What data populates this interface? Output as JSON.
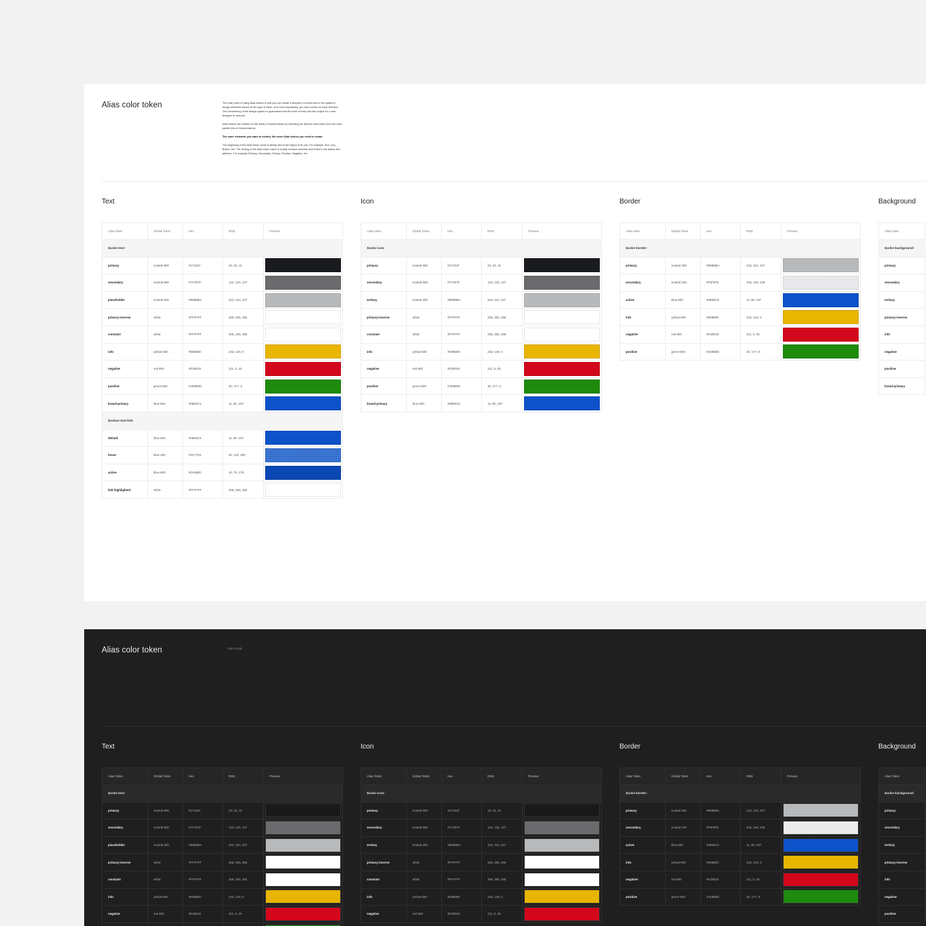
{
  "light": {
    "title": "Alias color token",
    "description": [
      "The main point of using Alias tokens is that you can create a structure of colors tied to the system's design elements based on the type of token. And most importantly, per color control for each element. The consistency of the design system is guaranteed and the level of entry into the project for a new designer is reduced.",
      "Alias tokens are created on the basis of Global tokens by selecting the desired color token from the color palette (list of Global tokens).",
      "The more elements you want to control, the more Alias tokens you need to create.",
      "The beginning of the Alias token name is strictly tied to the object of its use. For example Text, Icon, Button, etc. The ending of the Alias token name is mostly emotion-oriented and is tied to the status and attribute. For example Primary, Secondary, Tertiary, Positive, Negative, etc."
    ],
    "sections": [
      {
        "heading": "Text",
        "columns": [
          "Alias token",
          "Global Token",
          "Hex",
          "RGB",
          "Preview"
        ],
        "groups": [
          {
            "label": "$color-text-",
            "rows": [
              {
                "alias": "primary",
                "global": "neutral-900",
                "hex": "#17191F",
                "rgb": "23, 25, 31",
                "swatch": "#1a1b1f"
              },
              {
                "alias": "secondary",
                "global": "neutral-600",
                "hex": "#7A7E7F",
                "rgb": "122, 126, 127",
                "swatch": "#6b6b6e"
              },
              {
                "alias": "placeholder",
                "global": "neutral-300",
                "hex": "#B8B9BA",
                "rgb": "223, 224, 227",
                "swatch": "#b8b9bb"
              },
              {
                "alias": "primary-inverse",
                "global": "white",
                "hex": "#FFFFFF",
                "rgb": "255, 255, 255",
                "swatch": "#ffffff"
              },
              {
                "alias": "constant",
                "global": "white",
                "hex": "#FFFFFF",
                "rgb": "255, 255, 255",
                "swatch": "#ffffff"
              },
              {
                "alias": "info",
                "global": "yellow-600",
                "hex": "#E8B800",
                "rgb": "232, 149, 0",
                "swatch": "#e8b500"
              },
              {
                "alias": "negative",
                "global": "red-600",
                "hex": "#D30519",
                "rgb": "211, 5, 25",
                "swatch": "#d3061c"
              },
              {
                "alias": "positive",
                "global": "green-600",
                "hex": "#1E8B0D",
                "rgb": "30, 177, 0",
                "swatch": "#1e8b0d"
              },
              {
                "alias": "brand-primary",
                "global": "blue-500",
                "hex": "#0B50C5",
                "rgb": "11, 80, 197",
                "swatch": "#0d52c9"
              }
            ]
          },
          {
            "label": "$colour-text-link-",
            "rows": [
              {
                "alias": "default",
                "global": "blue-500",
                "hex": "#0B50C5",
                "rgb": "11, 80, 197",
                "swatch": "#0d52c9"
              },
              {
                "alias": "hover",
                "global": "blue-400",
                "hex": "#3C77D1",
                "rgb": "60, 119, 209",
                "swatch": "#3d78d8"
              },
              {
                "alias": "active",
                "global": "blue-600",
                "hex": "#0A46B0",
                "rgb": "10, 70, 176",
                "swatch": "#0a47b3"
              },
              {
                "alias": "link-highlighted",
                "global": "white",
                "hex": "#FFFFFF",
                "rgb": "255, 255, 255",
                "swatch": "#ffffff"
              }
            ]
          }
        ]
      },
      {
        "heading": "Icon",
        "columns": [
          "Alias token",
          "Global Token",
          "Hex",
          "RGB",
          "Preview"
        ],
        "groups": [
          {
            "label": "$color-icon-",
            "rows": [
              {
                "alias": "primary",
                "global": "neutral-900",
                "hex": "#17191F",
                "rgb": "23, 25, 31",
                "swatch": "#1a1b1f"
              },
              {
                "alias": "secondary",
                "global": "neutral-600",
                "hex": "#7A7E7F",
                "rgb": "122, 126, 127",
                "swatch": "#6b6b6e"
              },
              {
                "alias": "tertiary",
                "global": "neutral-300",
                "hex": "#B8B9BA",
                "rgb": "223, 224, 227",
                "swatch": "#b8b9bb"
              },
              {
                "alias": "primary-inverse",
                "global": "white",
                "hex": "#FFFFFF",
                "rgb": "255, 255, 255",
                "swatch": "#ffffff"
              },
              {
                "alias": "constant",
                "global": "white",
                "hex": "#FFFFFF",
                "rgb": "255, 255, 255",
                "swatch": "#ffffff"
              },
              {
                "alias": "info",
                "global": "yellow-600",
                "hex": "#E8B800",
                "rgb": "232, 149, 0",
                "swatch": "#e8b500"
              },
              {
                "alias": "negative",
                "global": "red-600",
                "hex": "#D30519",
                "rgb": "211, 5, 25",
                "swatch": "#d3061c"
              },
              {
                "alias": "positive",
                "global": "green-600",
                "hex": "#1E8B0D",
                "rgb": "30, 177, 0",
                "swatch": "#1e8b0d"
              },
              {
                "alias": "brand-primary",
                "global": "blue-500",
                "hex": "#0B50C5",
                "rgb": "11, 80, 197",
                "swatch": "#0d52c9"
              }
            ]
          }
        ]
      },
      {
        "heading": "Border",
        "columns": [
          "Alias token",
          "Global Token",
          "Hex",
          "RGB",
          "Preview"
        ],
        "groups": [
          {
            "label": "$color-border-",
            "rows": [
              {
                "alias": "primary",
                "global": "neutral-300",
                "hex": "#B8B9BA",
                "rgb": "223, 224, 227",
                "swatch": "#b8b9bb"
              },
              {
                "alias": "secondary",
                "global": "neutral-100",
                "hex": "#F5F6F6",
                "rgb": "245, 246, 246",
                "swatch": "#ececee"
              },
              {
                "alias": "active",
                "global": "blue-500",
                "hex": "#0B50C5",
                "rgb": "11, 80, 197",
                "swatch": "#0d52c9"
              },
              {
                "alias": "info",
                "global": "yellow-600",
                "hex": "#E8B800",
                "rgb": "232, 149, 0",
                "swatch": "#e8b500"
              },
              {
                "alias": "negative",
                "global": "red-600",
                "hex": "#D30519",
                "rgb": "211, 5, 25",
                "swatch": "#d3061c"
              },
              {
                "alias": "positive",
                "global": "green-600",
                "hex": "#1E8B0D",
                "rgb": "30, 177, 0",
                "swatch": "#1e8b0d"
              }
            ]
          }
        ]
      },
      {
        "heading": "Background",
        "columns": [
          "Alias token"
        ],
        "groups": [
          {
            "label": "$color-background-",
            "rows": [
              {
                "alias": "primary"
              },
              {
                "alias": "secondary"
              },
              {
                "alias": "tertiary"
              },
              {
                "alias": "primary-inverse"
              },
              {
                "alias": "info"
              },
              {
                "alias": "negative"
              },
              {
                "alias": "positive"
              },
              {
                "alias": "brand-primary"
              }
            ]
          }
        ]
      }
    ]
  },
  "dark": {
    "title": "Alias color token",
    "note": "Dark mode",
    "sections": [
      {
        "heading": "Text",
        "columns": [
          "Alias Token",
          "Global Token",
          "Hex",
          "RGB",
          "Preview"
        ],
        "groups": [
          {
            "label": "$color-text-",
            "rows": [
              {
                "alias": "primary",
                "global": "neutral-900",
                "hex": "#17191F",
                "rgb": "23, 25, 31",
                "swatch": "#19191b"
              },
              {
                "alias": "secondary",
                "global": "neutral-600",
                "hex": "#7A7E7F",
                "rgb": "122, 126, 127",
                "swatch": "#6b6b6e"
              },
              {
                "alias": "placeholder",
                "global": "neutral-300",
                "hex": "#B8B9BA",
                "rgb": "223, 224, 227",
                "swatch": "#b8b9bb"
              },
              {
                "alias": "primary-inverse",
                "global": "white",
                "hex": "#FFFFFF",
                "rgb": "255, 255, 255",
                "swatch": "#ffffff"
              },
              {
                "alias": "constant",
                "global": "white",
                "hex": "#FFFFFF",
                "rgb": "255, 255, 255",
                "swatch": "#ffffff"
              },
              {
                "alias": "info",
                "global": "yellow-600",
                "hex": "#E8B800",
                "rgb": "232, 149, 0",
                "swatch": "#e8b500"
              },
              {
                "alias": "negative",
                "global": "red-600",
                "hex": "#D30519",
                "rgb": "211, 5, 25",
                "swatch": "#d3061c"
              },
              {
                "swatch": "#1e8b0d"
              }
            ]
          }
        ]
      },
      {
        "heading": "Icon",
        "columns": [
          "Alias Token",
          "Global Token",
          "Hex",
          "RGB",
          "Preview"
        ],
        "groups": [
          {
            "label": "$color-icon-",
            "rows": [
              {
                "alias": "primary",
                "global": "neutral-900",
                "hex": "#17191F",
                "rgb": "23, 25, 31",
                "swatch": "#19191b"
              },
              {
                "alias": "secondary",
                "global": "neutral-600",
                "hex": "#7A7E7F",
                "rgb": "122, 126, 127",
                "swatch": "#6b6b6e"
              },
              {
                "alias": "tertiary",
                "global": "neutral-300",
                "hex": "#B8B9BA",
                "rgb": "223, 224, 227",
                "swatch": "#b8b9bb"
              },
              {
                "alias": "primary-inverse",
                "global": "white",
                "hex": "#FFFFFF",
                "rgb": "255, 255, 255",
                "swatch": "#ffffff"
              },
              {
                "alias": "constant",
                "global": "white",
                "hex": "#FFFFFF",
                "rgb": "255, 255, 255",
                "swatch": "#ffffff"
              },
              {
                "alias": "info",
                "global": "yellow-600",
                "hex": "#E8B800",
                "rgb": "232, 149, 0",
                "swatch": "#e8b500"
              },
              {
                "alias": "negative",
                "global": "red-600",
                "hex": "#D30519",
                "rgb": "211, 5, 25",
                "swatch": "#d3061c"
              }
            ]
          }
        ]
      },
      {
        "heading": "Border",
        "columns": [
          "Alias Token",
          "Global Token",
          "Hex",
          "RGB",
          "Preview"
        ],
        "groups": [
          {
            "label": "$color-border-",
            "rows": [
              {
                "alias": "primary",
                "global": "neutral-300",
                "hex": "#B8B9BA",
                "rgb": "223, 224, 227",
                "swatch": "#b8b9bb"
              },
              {
                "alias": "secondary",
                "global": "neutral-100",
                "hex": "#F5F6F6",
                "rgb": "245, 246, 246",
                "swatch": "#efeff0"
              },
              {
                "alias": "active",
                "global": "blue-500",
                "hex": "#0B50C5",
                "rgb": "11, 80, 197",
                "swatch": "#0d52c9"
              },
              {
                "alias": "info",
                "global": "yellow-600",
                "hex": "#E8B800",
                "rgb": "232, 149, 0",
                "swatch": "#e8b500"
              },
              {
                "alias": "negative",
                "global": "red-600",
                "hex": "#D30519",
                "rgb": "211, 5, 25",
                "swatch": "#d3061c"
              },
              {
                "alias": "positive",
                "global": "green-600",
                "hex": "#1E8B0D",
                "rgb": "30, 177, 0",
                "swatch": "#1e8b0d"
              }
            ]
          }
        ]
      },
      {
        "heading": "Background",
        "columns": [
          "Alias Token"
        ],
        "groups": [
          {
            "label": "$color-background-",
            "rows": [
              {
                "alias": "primary"
              },
              {
                "alias": "secondary"
              },
              {
                "alias": "tertiary"
              },
              {
                "alias": "primary-inverse"
              },
              {
                "alias": "info"
              },
              {
                "alias": "negative"
              },
              {
                "alias": "positive"
              }
            ]
          }
        ]
      }
    ]
  }
}
